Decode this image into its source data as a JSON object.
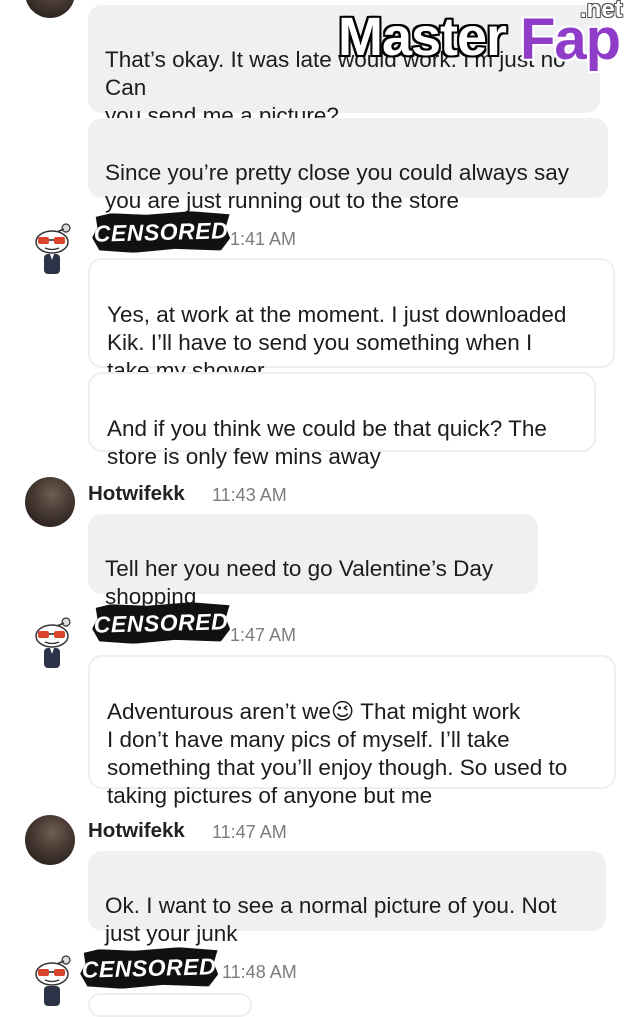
{
  "watermark": {
    "brand_a": "Master",
    "brand_b": "Fap",
    "tld": ".net"
  },
  "censor_label": "CENSORED",
  "messages": [
    {
      "text": "That’s okay. It was late would work. I’m just no Can\nyou send me a picture?"
    },
    {
      "text": "Since you’re pretty close you could always say\nyou are just running out to the store"
    },
    {
      "time": "1:41 AM"
    },
    {
      "text": "Yes, at work at the moment. I just downloaded\nKik. I’ll have to send you something when I\ntake my shower"
    },
    {
      "text": "And if you think we could be that quick? The\nstore is only few mins away"
    },
    {
      "user": "Hotwifekk",
      "time": "11:43 AM"
    },
    {
      "text": "Tell her you need to go Valentine’s Day\nshopping",
      "emoji": "😜"
    },
    {
      "time": "1:47 AM"
    },
    {
      "text_a": "Adventurous aren’t we",
      "emoji": "😉",
      "text_b": " That might work\nI don’t have many pics of myself. I’ll take\nsomething that you’ll enjoy though. So used to\ntaking pictures of anyone but me"
    },
    {
      "user": "Hotwifekk",
      "time": "11:47 AM"
    },
    {
      "text": "Ok. I want to see a normal picture of you. Not\njust your junk"
    },
    {
      "time": "11:48 AM"
    }
  ],
  "colors": {
    "bubble_grey": "#eef0f2",
    "timestamp": "#7c7c7c",
    "brand_purple": "#8f3cc9"
  },
  "icons": [
    "snoo-avatar-icon",
    "profile-photo-avatar"
  ]
}
